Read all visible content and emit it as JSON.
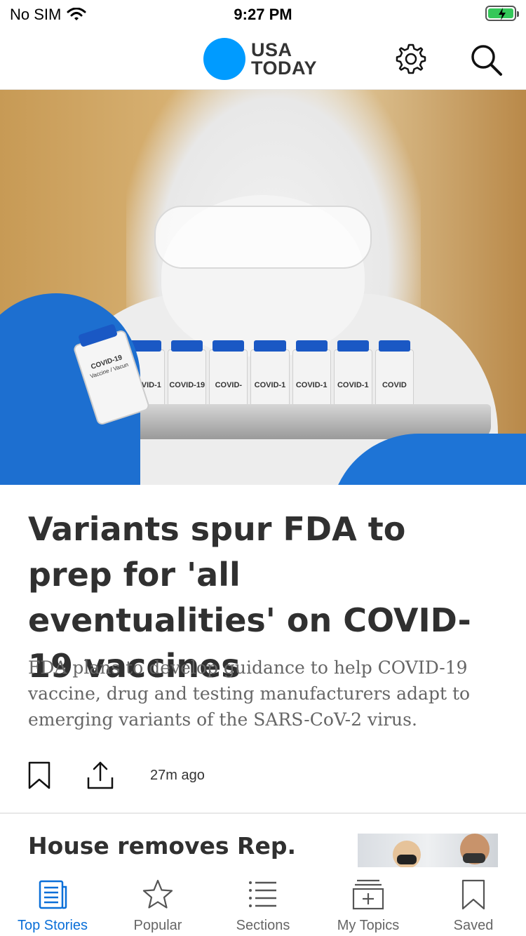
{
  "status_bar": {
    "carrier": "No SIM",
    "time": "9:27 PM",
    "battery_color": "#34c759"
  },
  "header": {
    "logo_line1": "USA",
    "logo_line2": "TODAY",
    "brand_color": "#009bff",
    "settings_icon": "gear-icon",
    "search_icon": "search-icon"
  },
  "hero": {
    "vial_single_label": "COVID-19",
    "vial_single_sub": "Vaccine / Vacun",
    "vial_labels": [
      "COVID-1",
      "COVID-19",
      "COVID-",
      "COVID-1",
      "COVID-1",
      "COVID-1",
      "COVID"
    ]
  },
  "article": {
    "headline": "Variants spur FDA to prep for 'all eventualities' on COVID-19 vaccines",
    "summary": "FDA plans to develop guidance to help COVID-19 vaccine, drug and testing manufacturers adapt to emerging variants of the SARS-CoV-2 virus.",
    "time_ago": "27m ago",
    "bookmark_icon": "bookmark-icon",
    "share_icon": "share-icon"
  },
  "story2": {
    "title": "House removes Rep."
  },
  "tab_bar": {
    "active_color": "#0a6fd8",
    "tabs": [
      {
        "label": "Top Stories",
        "icon": "newspaper-icon",
        "active": true
      },
      {
        "label": "Popular",
        "icon": "star-icon",
        "active": false
      },
      {
        "label": "Sections",
        "icon": "list-icon",
        "active": false
      },
      {
        "label": "My Topics",
        "icon": "add-topic-icon",
        "active": false
      },
      {
        "label": "Saved",
        "icon": "bookmark-icon",
        "active": false
      }
    ]
  }
}
